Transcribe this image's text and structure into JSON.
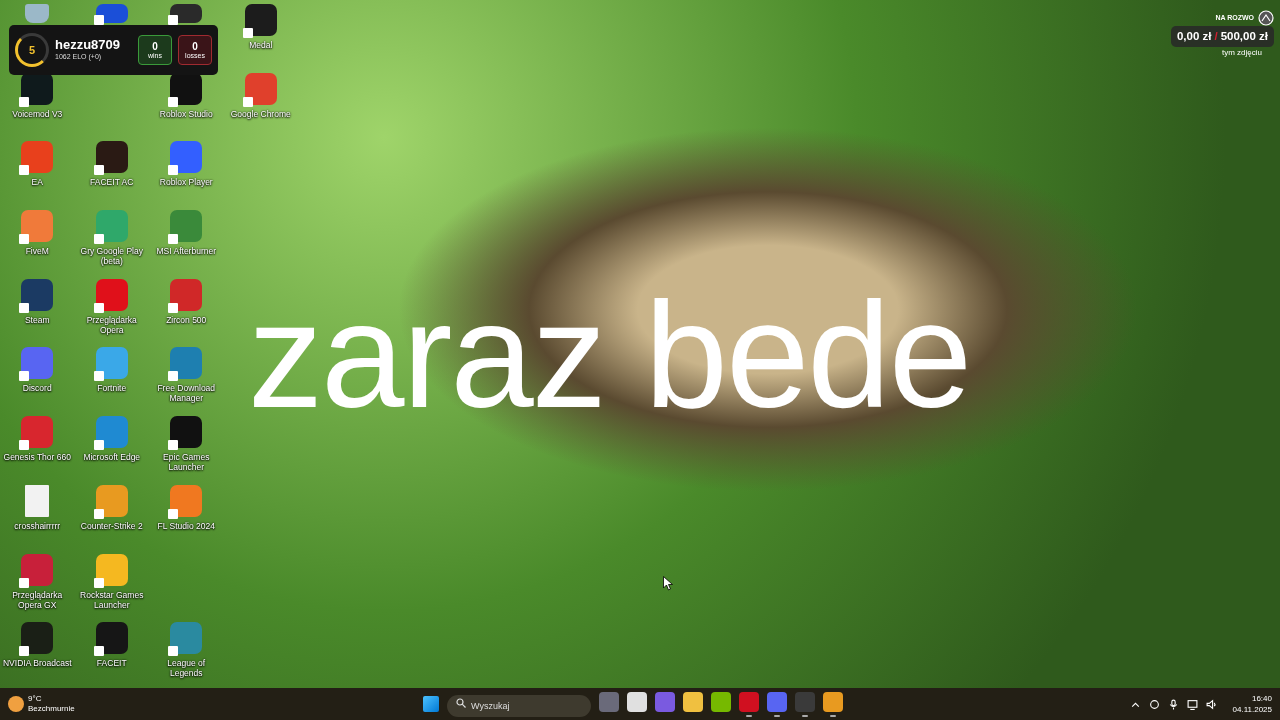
{
  "desktop": {
    "columns": [
      {
        "icons": [
          {
            "kind": "bin",
            "color": "#9bb8c8"
          },
          {
            "kind": "app",
            "label": "Voicemod V3",
            "color": "#0f1a1c"
          },
          {
            "kind": "app",
            "label": "EA",
            "color": "#e8401c"
          },
          {
            "kind": "app",
            "label": "FiveM",
            "color": "#f07a3a"
          },
          {
            "kind": "app",
            "label": "Steam",
            "color": "#1b3a63"
          },
          {
            "kind": "app",
            "label": "Discord",
            "color": "#5865f2"
          },
          {
            "kind": "app",
            "label": "Genesis Thor 660",
            "color": "#d8262e"
          },
          {
            "kind": "file",
            "label": "crosshairrrrr",
            "color": "#f2f2f2"
          },
          {
            "kind": "app",
            "label": "Przeglądarka Opera GX",
            "color": "#c8203a"
          },
          {
            "kind": "app",
            "label": "NVIDIA Broadcast",
            "color": "#1a1f16"
          }
        ]
      },
      {
        "icons": [
          {
            "kind": "app",
            "color": "#1b4fd8"
          },
          {
            "kind": "gap"
          },
          {
            "kind": "app",
            "label": "FACEIT AC",
            "color": "#2a1a14"
          },
          {
            "kind": "app",
            "label": "Gry Google Play (beta)",
            "color": "#2fa86a"
          },
          {
            "kind": "app",
            "label": "Przeglądarka Opera",
            "color": "#e0101a"
          },
          {
            "kind": "app",
            "label": "Fortnite",
            "color": "#3aa8e8"
          },
          {
            "kind": "app",
            "label": "Microsoft Edge",
            "color": "#1f8ad2"
          },
          {
            "kind": "app",
            "label": "Counter-Strike 2",
            "color": "#e89a20"
          },
          {
            "kind": "app",
            "label": "Rockstar Games Launcher",
            "color": "#f5b820"
          },
          {
            "kind": "app",
            "label": "FACEIT",
            "color": "#161616"
          }
        ]
      },
      {
        "icons": [
          {
            "kind": "app",
            "color": "#2a2a2a"
          },
          {
            "kind": "app",
            "label": "Roblox Studio",
            "color": "#111111"
          },
          {
            "kind": "app",
            "label": "Roblox Player",
            "color": "#335fff"
          },
          {
            "kind": "app",
            "label": "MSI Afterburner",
            "color": "#3a8a3a"
          },
          {
            "kind": "app",
            "label": "Zircon 500",
            "color": "#d02828"
          },
          {
            "kind": "app",
            "label": "Free Download Manager",
            "color": "#1e7fb0"
          },
          {
            "kind": "app",
            "label": "Epic Games Launcher",
            "color": "#111111"
          },
          {
            "kind": "app",
            "label": "FL Studio 2024",
            "color": "#f07820"
          },
          {
            "kind": "gap"
          },
          {
            "kind": "app",
            "label": "League of Legends",
            "color": "#2a8aa0"
          }
        ]
      },
      {
        "icons": [
          {
            "kind": "app",
            "label": "Medal",
            "color": "#1c1c1c"
          },
          {
            "kind": "app",
            "label": "Google Chrome",
            "color": "#e0402c"
          }
        ]
      }
    ]
  },
  "caption": "zaraz bede",
  "faceit_widget": {
    "level": "5",
    "username": "hezzu8709",
    "elo": "1062 ELO (+0)",
    "wins": {
      "value": "0",
      "label": "wins"
    },
    "losses": {
      "value": "0",
      "label": "losses"
    }
  },
  "donation_widget": {
    "heading": "NA ROZWO",
    "current": "0,00 zł",
    "separator": "/",
    "goal": "500,00 zł",
    "note": "tym zdjęciu"
  },
  "taskbar": {
    "weather": {
      "temperature": "9°C",
      "condition": "Bezchmurnie"
    },
    "search": {
      "placeholder": "Wyszukaj"
    },
    "apps": [
      {
        "color": "#6a6a7a",
        "running": false
      },
      {
        "color": "#e0e0e0",
        "running": false
      },
      {
        "color": "#7a5ae0",
        "running": false
      },
      {
        "color": "#f0c040",
        "running": false
      },
      {
        "color": "#76b900",
        "running": false
      },
      {
        "color": "#d01020",
        "running": true
      },
      {
        "color": "#5865f2",
        "running": true
      },
      {
        "color": "#3a3a3a",
        "running": true
      },
      {
        "color": "#e89a20",
        "running": true
      }
    ],
    "time": "16:40",
    "date": "04.11.2025"
  }
}
